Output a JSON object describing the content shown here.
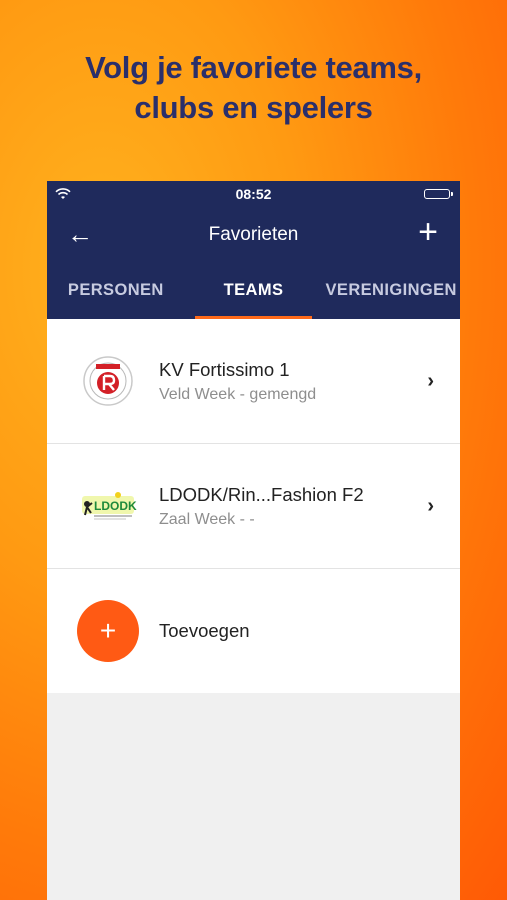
{
  "headline": {
    "line1": "Volg je favoriete teams,",
    "line2": "clubs en spelers"
  },
  "status": {
    "time": "08:52"
  },
  "nav": {
    "title": "Favorieten",
    "back_icon": "←",
    "add_icon": "+"
  },
  "tabs": [
    {
      "label": "PERSONEN",
      "active": false
    },
    {
      "label": "TEAMS",
      "active": true
    },
    {
      "label": "VERENIGINGEN",
      "active": false
    }
  ],
  "teams": [
    {
      "name": "KV Fortissimo 1",
      "subtitle": "Veld Week - gemengd",
      "logo": "fortissimo-logo"
    },
    {
      "name": "LDODK/Rin...Fashion F2",
      "subtitle": "Zaal Week - -",
      "logo": "ldodk-logo"
    }
  ],
  "add": {
    "label": "Toevoegen",
    "icon": "+"
  },
  "chevron": "›",
  "colors": {
    "navbar": "#1f2a5c",
    "accent": "#ff5a14",
    "headline": "#2a2f6b"
  }
}
